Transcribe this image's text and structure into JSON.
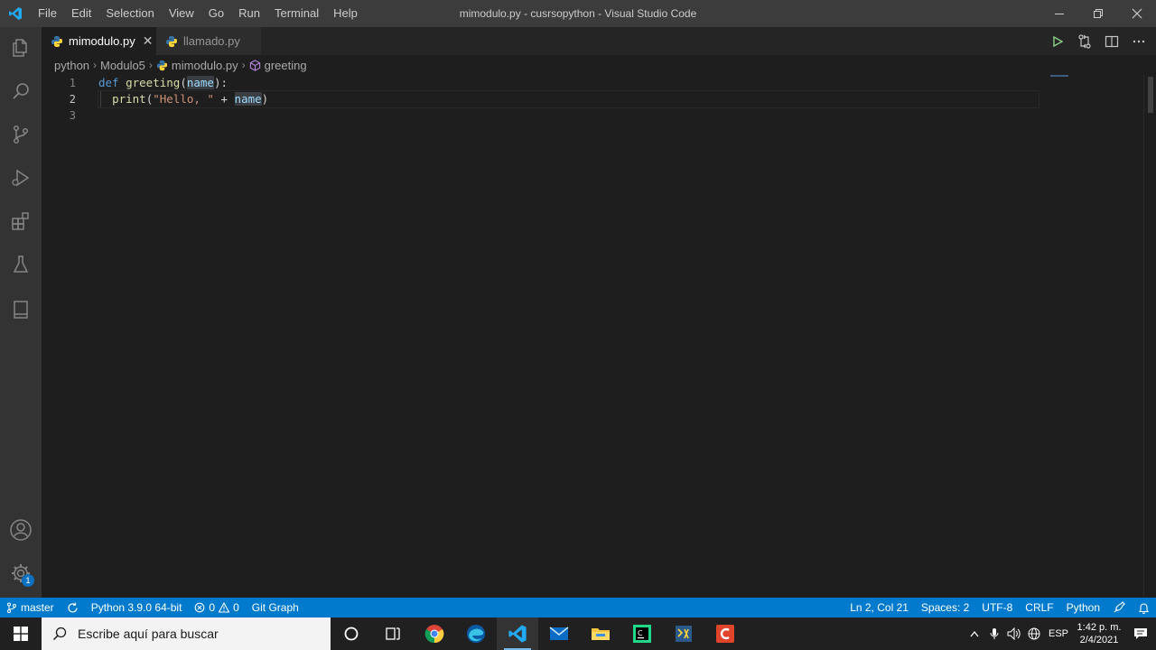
{
  "titlebar": {
    "menu": [
      "File",
      "Edit",
      "Selection",
      "View",
      "Go",
      "Run",
      "Terminal",
      "Help"
    ],
    "title": "mimodulo.py - cusrsopython - Visual Studio Code"
  },
  "tabs": [
    {
      "label": "mimodulo.py",
      "active": true,
      "close": "✕"
    },
    {
      "label": "llamado.py",
      "active": false
    }
  ],
  "breadcrumb": {
    "parts": [
      "python",
      "Modulo5",
      "mimodulo.py",
      "greeting"
    ],
    "sep": "›"
  },
  "editor": {
    "line_numbers": [
      "1",
      "2",
      "3"
    ],
    "current_line": 2,
    "code": {
      "l1": {
        "kw": "def",
        "fn": "greeting",
        "open": "(",
        "param": "name",
        "close": "):"
      },
      "l2": {
        "fn": "print",
        "open": "(",
        "str": "\"Hello, \"",
        "op": " + ",
        "param": "name",
        "close": ")"
      }
    }
  },
  "activitybar": {
    "icons": [
      "explorer-icon",
      "search-icon",
      "source-control-icon",
      "run-debug-icon",
      "extensions-icon",
      "testing-icon",
      "book-icon",
      "account-icon",
      "settings-gear-icon"
    ],
    "settings_badge": "1"
  },
  "statusbar": {
    "branch": "master",
    "interpreter": "Python 3.9.0 64-bit",
    "errors": "0",
    "warnings": "0",
    "git_graph": "Git Graph",
    "position": "Ln 2, Col 21",
    "spaces": "Spaces: 2",
    "encoding": "UTF-8",
    "eol": "CRLF",
    "language": "Python"
  },
  "taskbar": {
    "search_placeholder": "Escribe aquí para buscar",
    "apps": [
      "cortana-icon",
      "task-view-icon",
      "chrome-icon",
      "edge-icon",
      "vscode-icon",
      "mail-icon",
      "file-explorer-icon",
      "pycharm-icon",
      "app-icon",
      "camtasia-icon"
    ],
    "lang": "ESP",
    "time": "1:42 p. m.",
    "date": "2/4/2021"
  },
  "colors": {
    "accent": "#007acc",
    "keyword": "#569cd6",
    "function": "#dcdcaa",
    "parameter": "#9cdcfe",
    "string": "#ce9178"
  }
}
